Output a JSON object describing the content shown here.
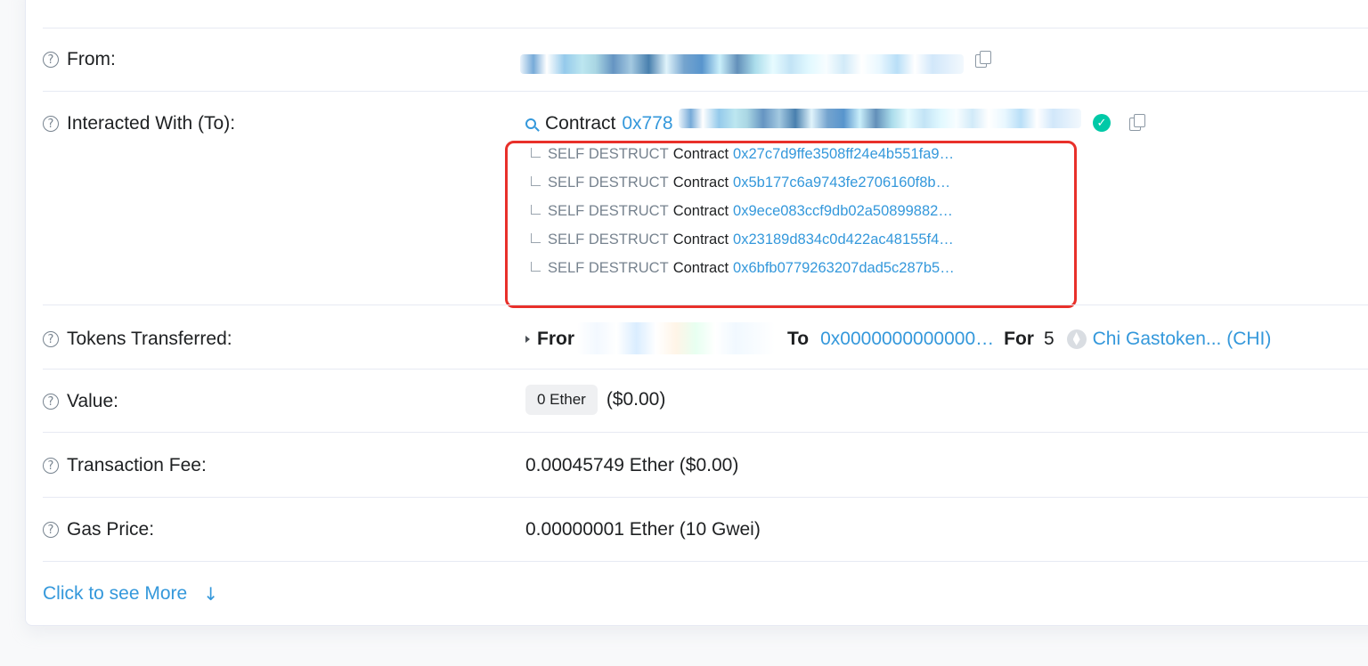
{
  "rows": {
    "from": {
      "label": "From:"
    },
    "interacted": {
      "label": "Interacted With (To):",
      "contract_word": "Contract",
      "address_partial": "0x778"
    },
    "traces": [
      {
        "kind": "SELF DESTRUCT",
        "word": "Contract",
        "address": "0x27c7d9ffe3508ff24e4b551fa9…"
      },
      {
        "kind": "SELF DESTRUCT",
        "word": "Contract",
        "address": "0x5b177c6a9743fe2706160f8b…"
      },
      {
        "kind": "SELF DESTRUCT",
        "word": "Contract",
        "address": "0x9ece083ccf9db02a50899882…"
      },
      {
        "kind": "SELF DESTRUCT",
        "word": "Contract",
        "address": "0x23189d834c0d422ac48155f4…"
      },
      {
        "kind": "SELF DESTRUCT",
        "word": "Contract",
        "address": "0x6bfb0779263207dad5c287b5…"
      }
    ],
    "tokens": {
      "label": "Tokens Transferred:",
      "from_word": "Fror",
      "to_word": "To",
      "to_address": "0x0000000000000…",
      "for_word": "For",
      "amount": "5",
      "token_name": "Chi Gastoken... (CHI)"
    },
    "value": {
      "label": "Value:",
      "badge": "0 Ether",
      "usd": "($0.00)"
    },
    "fee": {
      "label": "Transaction Fee:",
      "text": "0.00045749 Ether ($0.00)"
    },
    "gas": {
      "label": "Gas Price:",
      "text": "0.00000001 Ether (10 Gwei)"
    }
  },
  "more_link": "Click to see More",
  "colors": {
    "link": "#3498db",
    "highlight": "#e8302a",
    "check": "#00c9a7"
  }
}
